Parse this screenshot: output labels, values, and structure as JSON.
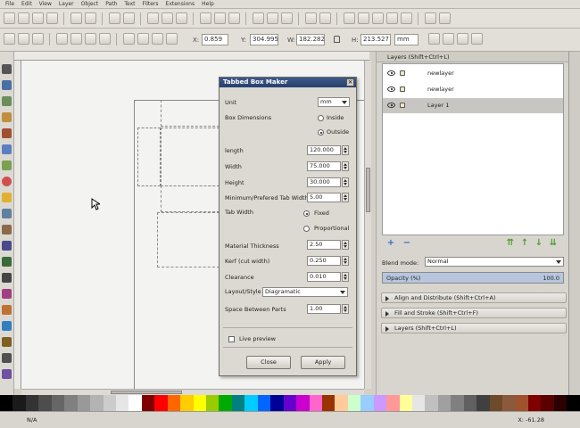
{
  "menu": [
    "File",
    "Edit",
    "View",
    "Layer",
    "Object",
    "Path",
    "Text",
    "Filters",
    "Extensions",
    "Help"
  ],
  "controls": {
    "x_label": "X:",
    "x_value": "0.859",
    "y_label": "Y:",
    "y_value": "304.995",
    "w_label": "W:",
    "w_value": "182.282",
    "h_label": "H:",
    "h_value": "213.527",
    "unit": "mm"
  },
  "dialog": {
    "title": "Tabbed Box Maker",
    "unit_label": "Unit",
    "unit_value": "mm",
    "box_dimensions_label": "Box Dimensions",
    "inside_label": "Inside",
    "outside_label": "Outside",
    "length_label": "length",
    "length_value": "120.000",
    "width_label": "Width",
    "width_value": "75.000",
    "height_label": "Height",
    "height_value": "30.000",
    "tab_width_min_label": "Minimum/Prefered Tab Width",
    "tab_width_min_value": "5.00",
    "tab_width_label": "Tab Width",
    "fixed_label": "Fixed",
    "proportional_label": "Proportional",
    "material_label": "Material Thickness",
    "material_value": "2.50",
    "kerf_label": "Kerf (cut width)",
    "kerf_value": "0.250",
    "clearance_label": "Clearance",
    "clearance_value": "0.010",
    "layout_label": "Layout/Style",
    "layout_value": "Diagramatic",
    "space_label": "Space Between Parts",
    "space_value": "1.00",
    "live_preview_label": "Live preview",
    "close_label": "Close",
    "apply_label": "Apply"
  },
  "layers_panel": {
    "title": "Layers (Shift+Ctrl+L)",
    "layers": [
      {
        "name": "newlayer"
      },
      {
        "name": "newlayer"
      },
      {
        "name": "Layer 1"
      }
    ],
    "blend_label": "Blend mode:",
    "blend_value": "Normal",
    "opacity_label": "Opacity (%)",
    "opacity_value": "100.0"
  },
  "dock_panels": [
    "Align and Distribute (Shift+Ctrl+A)",
    "Fill and Stroke (Shift+Ctrl+F)",
    "Layers (Shift+Ctrl+L)"
  ],
  "status": {
    "left_text": "N/A",
    "coords": "X: -61.28"
  },
  "palette_colors": [
    "#000000",
    "#1a1a1a",
    "#333333",
    "#4d4d4d",
    "#666666",
    "#808080",
    "#999999",
    "#b3b3b3",
    "#cccccc",
    "#e6e6e6",
    "#ffffff",
    "#800000",
    "#ff0000",
    "#ff6600",
    "#ffcc00",
    "#ffff00",
    "#99cc00",
    "#00aa00",
    "#008080",
    "#00ccff",
    "#0066ff",
    "#000099",
    "#6600cc",
    "#cc00cc",
    "#ff66cc",
    "#993300",
    "#ffcc99",
    "#ccffcc",
    "#99ccff",
    "#cc99ff",
    "#ff9999",
    "#ffff99",
    "#e6e6e6",
    "#c0c0c0",
    "#a0a0a0",
    "#808080",
    "#606060",
    "#404040",
    "#6d4a2a",
    "#8b5a3c",
    "#a0522d",
    "#800000",
    "#5a0000",
    "#2b0000",
    "#000000"
  ]
}
